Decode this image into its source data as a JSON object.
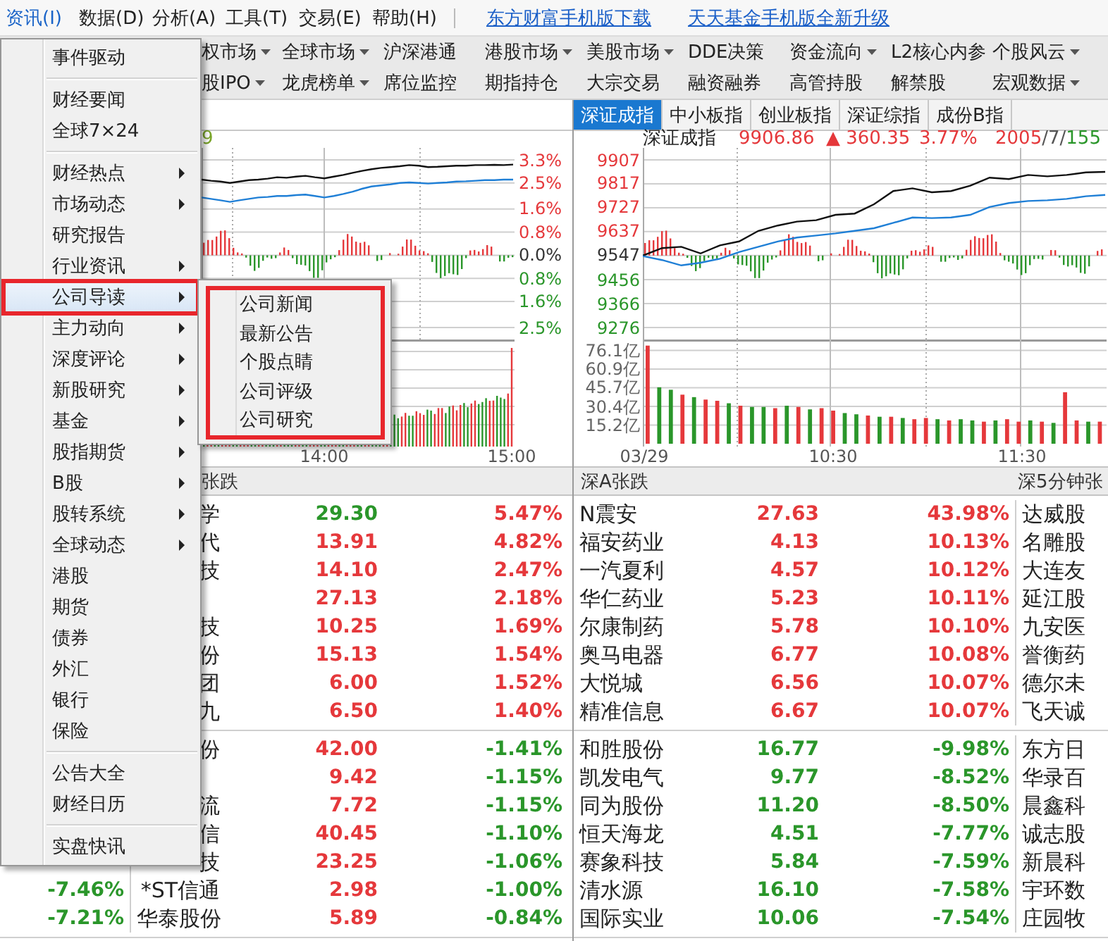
{
  "menu_bar": {
    "items": [
      {
        "label": "资讯(I)",
        "selected": true
      },
      {
        "label": "数据(D)",
        "selected": false
      },
      {
        "label": "分析(A)",
        "selected": false
      },
      {
        "label": "工具(T)",
        "selected": false
      },
      {
        "label": "交易(E)",
        "selected": false
      },
      {
        "label": "帮助(H)",
        "selected": false
      }
    ],
    "links": [
      "东方财富手机版下载",
      "天天基金手机版全新升级"
    ]
  },
  "toolbar": {
    "rows": [
      [
        {
          "label": "权市场",
          "dropdown": true
        },
        {
          "label": "全球市场",
          "dropdown": true
        },
        {
          "label": "沪深港通",
          "dropdown": false
        },
        {
          "label": "港股市场",
          "dropdown": true
        },
        {
          "label": "美股市场",
          "dropdown": true
        },
        {
          "label": "DDE决策",
          "dropdown": false
        },
        {
          "label": "资金流向",
          "dropdown": true
        },
        {
          "label": "L2核心内参",
          "dropdown": false
        },
        {
          "label": "个股风云",
          "dropdown": true
        }
      ],
      [
        {
          "label": "股IPO",
          "dropdown": true
        },
        {
          "label": "龙虎榜单",
          "dropdown": true
        },
        {
          "label": "席位监控",
          "dropdown": false
        },
        {
          "label": "期指持仓",
          "dropdown": false
        },
        {
          "label": "大宗交易",
          "dropdown": false
        },
        {
          "label": "融资融券",
          "dropdown": false
        },
        {
          "label": "高管持股",
          "dropdown": false
        },
        {
          "label": "解禁股",
          "dropdown": false
        },
        {
          "label": "宏观数据",
          "dropdown": true
        }
      ]
    ]
  },
  "left_chart": {
    "fragment": "9",
    "chart_data": {
      "type": "line",
      "grid": true,
      "ylim": [
        -2.5,
        3.3
      ],
      "yticks": [
        {
          "value": 3.3,
          "label": "3.3%"
        },
        {
          "value": 2.5,
          "label": "2.5%"
        },
        {
          "value": 1.6,
          "label": "1.6%"
        },
        {
          "value": 0.8,
          "label": "0.8%"
        },
        {
          "value": 0,
          "label": "0.0%"
        },
        {
          "value": -0.8,
          "label": "0.8%"
        },
        {
          "value": -1.6,
          "label": "1.6%"
        },
        {
          "value": -2.5,
          "label": "2.5%"
        }
      ],
      "series": [
        {
          "color": "#111111",
          "values": [
            2.62,
            2.58,
            2.55,
            2.5,
            2.55,
            2.6,
            2.62,
            2.65,
            2.7,
            2.68,
            2.72,
            2.75,
            2.7,
            2.66,
            2.72,
            2.78,
            2.85,
            2.92,
            2.98,
            3.02,
            3.05,
            3.08,
            3.12,
            3.1,
            3.05,
            3.06,
            3.08,
            3.1,
            3.1,
            3.12,
            3.12,
            3.13,
            3.12,
            3.14
          ]
        },
        {
          "color": "#1f7fd6",
          "values": [
            2.0,
            1.95,
            1.9,
            1.85,
            1.9,
            1.95,
            2.0,
            2.02,
            2.05,
            2.05,
            2.08,
            2.1,
            2.05,
            2.0,
            2.05,
            2.12,
            2.2,
            2.3,
            2.38,
            2.42,
            2.45,
            2.5,
            2.52,
            2.5,
            2.48,
            2.5,
            2.52,
            2.55,
            2.56,
            2.58,
            2.6,
            2.6,
            2.62,
            2.62
          ]
        }
      ]
    },
    "time_axis": [
      "14:00",
      "15:00"
    ]
  },
  "right_chart": {
    "tabs": [
      {
        "label": "深证成指",
        "selected": true
      },
      {
        "label": "中小板指",
        "selected": false
      },
      {
        "label": "创业板指",
        "selected": false
      },
      {
        "label": "深证综指",
        "selected": false
      },
      {
        "label": "成份B指",
        "selected": false
      }
    ],
    "header": {
      "name": "深证成指",
      "value": "9906.86",
      "change": "▲ 360.35",
      "percent": "3.77%",
      "breadth": [
        {
          "text": "2005",
          "color": "#e5383b"
        },
        {
          "text": "/",
          "color": "#555555"
        },
        {
          "text": "7",
          "color": "#555555"
        },
        {
          "text": "/",
          "color": "#555555"
        },
        {
          "text": "155",
          "color": "#2a962a"
        }
      ]
    },
    "price_panel": {
      "chart_data": {
        "type": "line",
        "grid": true,
        "ylim": [
          9276,
          9907
        ],
        "yticks": [
          {
            "value": 9907,
            "label": "9907"
          },
          {
            "value": 9817,
            "label": "9817"
          },
          {
            "value": 9727,
            "label": "9727"
          },
          {
            "value": 9637,
            "label": "9637"
          },
          {
            "value": 9547,
            "label": "9547"
          },
          {
            "value": 9456,
            "label": "9456"
          },
          {
            "value": 9366,
            "label": "9366"
          },
          {
            "value": 9276,
            "label": "9276"
          }
        ],
        "series": [
          {
            "color": "#111111",
            "values": [
              9547,
              9575,
              9580,
              9555,
              9585,
              9600,
              9640,
              9660,
              9675,
              9680,
              9700,
              9705,
              9740,
              9790,
              9800,
              9785,
              9790,
              9810,
              9840,
              9835,
              9850,
              9845,
              9850,
              9860,
              9862
            ]
          },
          {
            "color": "#1f7fd6",
            "values": [
              9545,
              9530,
              9510,
              9520,
              9535,
              9560,
              9580,
              9600,
              9615,
              9622,
              9630,
              9640,
              9650,
              9670,
              9690,
              9688,
              9690,
              9700,
              9730,
              9745,
              9752,
              9755,
              9760,
              9770,
              9775
            ]
          }
        ]
      }
    },
    "volume_panel": {
      "chart_data": {
        "type": "bar",
        "grid": true,
        "ylim": [
          0,
          82
        ],
        "yticks": [
          {
            "value": 76.1,
            "label": "76.1亿"
          },
          {
            "value": 60.9,
            "label": "60.9亿"
          },
          {
            "value": 45.7,
            "label": "45.7亿"
          },
          {
            "value": 30.4,
            "label": "30.4亿"
          },
          {
            "value": 15.2,
            "label": "15.2亿"
          }
        ],
        "series": [
          {
            "color": "#e5383b",
            "values": [
              80,
              null,
              null,
              40,
              null,
              36,
              35,
              null,
              31,
              null,
              null,
              29,
              null,
              30,
              null,
              29,
              27,
              null,
              null,
              23,
              null,
              22,
              null,
              20,
              21,
              null,
              19,
              null,
              null,
              18,
              null,
              20,
              18,
              null,
              18,
              null,
              42,
              19,
              null,
              18
            ]
          },
          {
            "color": "#2a962a",
            "values": [
              null,
              46,
              44,
              null,
              38,
              null,
              null,
              33,
              null,
              30,
              30,
              null,
              31,
              null,
              28,
              null,
              null,
              25,
              24,
              null,
              22,
              null,
              21,
              null,
              null,
              20,
              null,
              20,
              19,
              null,
              19,
              null,
              null,
              19,
              null,
              17,
              null,
              null,
              18,
              null
            ]
          }
        ]
      }
    },
    "time_axis": [
      "03/29",
      "10:30",
      "11:30"
    ]
  },
  "left_table": {
    "header": "张跌",
    "sections": [
      {
        "rows": [
          {
            "name": "学",
            "price": {
              "text": "29.30",
              "color": "#2a962a"
            },
            "pct": {
              "text": "5.47%",
              "color": "#e5383b"
            }
          },
          {
            "name": "代",
            "price": {
              "text": "13.91",
              "color": "#e5383b"
            },
            "pct": {
              "text": "4.82%",
              "color": "#e5383b"
            }
          },
          {
            "name": "技",
            "price": {
              "text": "14.10",
              "color": "#e5383b"
            },
            "pct": {
              "text": "2.47%",
              "color": "#e5383b"
            }
          },
          {
            "price": {
              "text": "27.13",
              "color": "#e5383b"
            },
            "pct": {
              "text": "2.18%",
              "color": "#e5383b"
            }
          },
          {
            "name": "技",
            "price": {
              "text": "10.25",
              "color": "#e5383b"
            },
            "pct": {
              "text": "1.69%",
              "color": "#e5383b"
            }
          },
          {
            "name": "份",
            "price": {
              "text": "15.13",
              "color": "#e5383b"
            },
            "pct": {
              "text": "1.54%",
              "color": "#e5383b"
            }
          },
          {
            "name": "团",
            "price": {
              "text": "6.00",
              "color": "#e5383b"
            },
            "pct": {
              "text": "1.52%",
              "color": "#e5383b"
            }
          },
          {
            "name": "九",
            "price": {
              "text": "6.50",
              "color": "#e5383b"
            },
            "pct": {
              "text": "1.40%",
              "color": "#e5383b"
            }
          }
        ]
      },
      {
        "rows": [
          {
            "name": "份",
            "price": {
              "text": "42.00",
              "color": "#e5383b"
            },
            "pct": {
              "text": "-1.41%",
              "color": "#2a962a"
            }
          },
          {
            "price": {
              "text": "9.42",
              "color": "#e5383b"
            },
            "pct": {
              "text": "-1.15%",
              "color": "#2a962a"
            }
          },
          {
            "name": "流",
            "price": {
              "text": "7.72",
              "color": "#e5383b"
            },
            "pct": {
              "text": "-1.15%",
              "color": "#2a962a"
            }
          },
          {
            "name": "信",
            "price": {
              "text": "40.45",
              "color": "#e5383b"
            },
            "pct": {
              "text": "-1.10%",
              "color": "#2a962a"
            }
          },
          {
            "name": "技",
            "price": {
              "text": "23.25",
              "color": "#e5383b"
            },
            "pct": {
              "text": "-1.06%",
              "color": "#2a962a"
            }
          },
          {
            "left_pct": {
              "text": "-7.46%",
              "color": "#2a962a"
            },
            "name": "*ST信通",
            "price": {
              "text": "2.98",
              "color": "#e5383b"
            },
            "pct": {
              "text": "-1.00%",
              "color": "#2a962a"
            }
          },
          {
            "left_pct": {
              "text": "-7.21%",
              "color": "#2a962a"
            },
            "name": "华泰股份",
            "price": {
              "text": "5.89",
              "color": "#e5383b"
            },
            "pct": {
              "text": "-0.84%",
              "color": "#2a962a"
            }
          }
        ]
      }
    ]
  },
  "right_table": {
    "headers": [
      "深A张跌",
      "深5分钟张"
    ],
    "sections": [
      {
        "rows": [
          {
            "name": "N震安",
            "price": "27.63",
            "pct": "43.98%",
            "color": "#e5383b",
            "side_name": "达威股"
          },
          {
            "name": "福安药业",
            "price": "4.13",
            "pct": "10.13%",
            "color": "#e5383b",
            "side_name": "名雕股"
          },
          {
            "name": "一汽夏利",
            "price": "4.57",
            "pct": "10.12%",
            "color": "#e5383b",
            "side_name": "大连友"
          },
          {
            "name": "华仁药业",
            "price": "5.23",
            "pct": "10.11%",
            "color": "#e5383b",
            "side_name": "延江股"
          },
          {
            "name": "尔康制药",
            "price": "5.78",
            "pct": "10.10%",
            "color": "#e5383b",
            "side_name": "九安医"
          },
          {
            "name": "奥马电器",
            "price": "6.77",
            "pct": "10.08%",
            "color": "#e5383b",
            "side_name": "誉衡药"
          },
          {
            "name": "大悦城",
            "price": "6.56",
            "pct": "10.07%",
            "color": "#e5383b",
            "side_name": "德尔未"
          },
          {
            "name": "精准信息",
            "price": "6.67",
            "pct": "10.07%",
            "color": "#e5383b",
            "side_name": "飞天诚"
          }
        ]
      },
      {
        "rows": [
          {
            "name": "和胜股份",
            "price": "16.77",
            "pct": "-9.98%",
            "color": "#2a962a",
            "side_name": "东方日"
          },
          {
            "name": "凯发电气",
            "price": "9.77",
            "pct": "-8.52%",
            "color": "#2a962a",
            "side_name": "华录百"
          },
          {
            "name": "同为股份",
            "price": "11.20",
            "pct": "-8.50%",
            "color": "#2a962a",
            "side_name": "晨鑫科"
          },
          {
            "name": "恒天海龙",
            "price": "4.51",
            "pct": "-7.77%",
            "color": "#2a962a",
            "side_name": "诚志股"
          },
          {
            "name": "赛象科技",
            "price": "5.84",
            "pct": "-7.59%",
            "color": "#2a962a",
            "side_name": "新晨科"
          },
          {
            "name": "清水源",
            "price": "16.10",
            "pct": "-7.58%",
            "color": "#2a962a",
            "side_name": "宇环数"
          },
          {
            "name": "国际实业",
            "price": "10.06",
            "pct": "-7.54%",
            "color": "#2a962a",
            "side_name": "庄园牧"
          }
        ]
      }
    ]
  },
  "menu": {
    "groups": [
      {
        "items": [
          {
            "label": "事件驱动",
            "selected": false,
            "submenu": false
          }
        ]
      },
      {
        "items": [
          {
            "label": "财经要闻",
            "selected": false,
            "submenu": false
          },
          {
            "label": "全球7×24",
            "selected": false,
            "submenu": false
          }
        ]
      },
      {
        "items": [
          {
            "label": "财经热点",
            "selected": false,
            "submenu": true
          },
          {
            "label": "市场动态",
            "selected": false,
            "submenu": true
          },
          {
            "label": "研究报告",
            "selected": false,
            "submenu": false
          },
          {
            "label": "行业资讯",
            "selected": false,
            "submenu": true
          },
          {
            "label": "公司导读",
            "selected": true,
            "submenu": true
          },
          {
            "label": "主力动向",
            "selected": false,
            "submenu": true
          },
          {
            "label": "深度评论",
            "selected": false,
            "submenu": true
          },
          {
            "label": "新股研究",
            "selected": false,
            "submenu": true
          },
          {
            "label": "基金",
            "selected": false,
            "submenu": true
          },
          {
            "label": "股指期货",
            "selected": false,
            "submenu": true
          },
          {
            "label": "B股",
            "selected": false,
            "submenu": true
          },
          {
            "label": "股转系统",
            "selected": false,
            "submenu": true
          },
          {
            "label": "全球动态",
            "selected": false,
            "submenu": true
          },
          {
            "label": "港股",
            "selected": false,
            "submenu": false
          },
          {
            "label": "期货",
            "selected": false,
            "submenu": false
          },
          {
            "label": "债券",
            "selected": false,
            "submenu": false
          },
          {
            "label": "外汇",
            "selected": false,
            "submenu": false
          },
          {
            "label": "银行",
            "selected": false,
            "submenu": false
          },
          {
            "label": "保险",
            "selected": false,
            "submenu": false
          }
        ]
      },
      {
        "items": [
          {
            "label": "公告大全",
            "selected": false,
            "submenu": false
          },
          {
            "label": "财经日历",
            "selected": false,
            "submenu": false
          }
        ]
      },
      {
        "items": [
          {
            "label": "实盘快讯",
            "selected": false,
            "submenu": false
          }
        ]
      }
    ]
  },
  "submenu": {
    "annotated": true,
    "items": [
      "公司新闻",
      "最新公告",
      "个股点睛",
      "公司评级",
      "公司研究"
    ]
  }
}
